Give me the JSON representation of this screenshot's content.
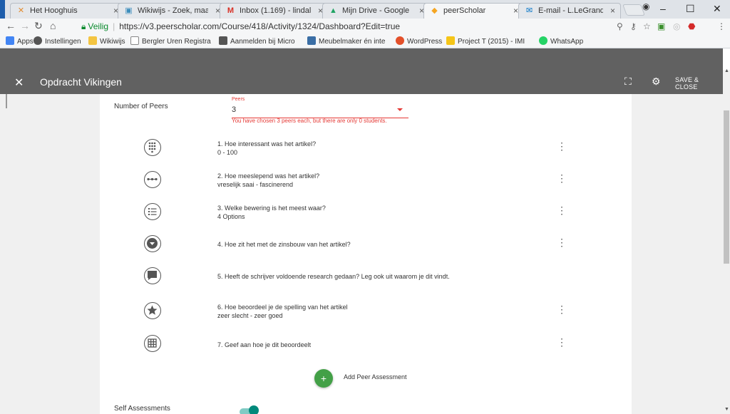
{
  "tabs": [
    {
      "title": "Het Hooghuis",
      "icon": "hooghuis-icon"
    },
    {
      "title": "Wikiwijs - Zoek, maak",
      "icon": "wikiwijs-icon"
    },
    {
      "title": "Inbox (1.169) - lindal",
      "icon": "gmail-icon"
    },
    {
      "title": "Mijn Drive - Google D",
      "icon": "drive-icon"
    },
    {
      "title": "peerScholar",
      "icon": "peerscholar-icon"
    },
    {
      "title": "E-mail - L.LeGrand@",
      "icon": "outlook-icon"
    }
  ],
  "address": {
    "secure_label": "Veilig",
    "url": "https://v3.peerscholar.com/Course/418/Activity/1324/Dashboard?Edit=true"
  },
  "bookmarks": [
    {
      "label": "Apps",
      "icon": "apps-icon",
      "color": "#4285f4"
    },
    {
      "label": "Instellingen",
      "icon": "gear-icon",
      "color": "#555555"
    },
    {
      "label": "Wikiwijs",
      "icon": "folder-icon",
      "color": "#f4c542"
    },
    {
      "label": "Bergler Uren Registra",
      "icon": "page-icon",
      "color": "#888888"
    },
    {
      "label": "Aanmelden bij Micro",
      "icon": "microsoft-icon",
      "color": "#555555"
    },
    {
      "label": "Meubelmaker én inte",
      "icon": "meubelmaker-icon",
      "color": "#3a6ea5"
    },
    {
      "label": "WordPress",
      "icon": "wordpress-icon",
      "color": "#e3502a"
    },
    {
      "label": "Project T (2015) - IMI",
      "icon": "imdb-icon",
      "color": "#f5c518"
    },
    {
      "label": "WhatsApp",
      "icon": "whatsapp-icon",
      "color": "#25d366"
    }
  ],
  "header": {
    "title": "Opdracht Vikingen",
    "save_close": "SAVE & CLOSE"
  },
  "peers": {
    "label": "Number of Peers",
    "field_label": "Peers",
    "value": "3",
    "error": "You have chosen 3 peers each, but there are only 0 students."
  },
  "questions": [
    {
      "title": "1. Hoe interessant was het artikel?",
      "sub": "0 - 100",
      "icon": "numeric-keypad-icon"
    },
    {
      "title": "2. Hoe meeslepend was het artikel?",
      "sub": "vreselijk saai - fascinerend",
      "icon": "slider-scale-icon"
    },
    {
      "title": "3. Welke bewering is het meest waar?",
      "sub": "4 Options",
      "icon": "list-icon"
    },
    {
      "title": "4. Hoe zit het met de zinsbouw van het artikel?",
      "sub": "",
      "icon": "dropdown-icon"
    },
    {
      "title": "5. Heeft de schrijver voldoende research gedaan? Leg ook uit waarom je dit vindt.",
      "sub": "",
      "icon": "comment-icon"
    },
    {
      "title": "6. Hoe beoordeel je de spelling van het artikel",
      "sub": "zeer slecht - zeer goed",
      "icon": "star-icon"
    },
    {
      "title": "7. Geef aan hoe je dit beoordeelt",
      "sub": "",
      "icon": "grid-icon"
    }
  ],
  "add_peer": {
    "label": "Add Peer Assessment"
  },
  "self": {
    "label": "Self Assessments",
    "enabled": true
  }
}
